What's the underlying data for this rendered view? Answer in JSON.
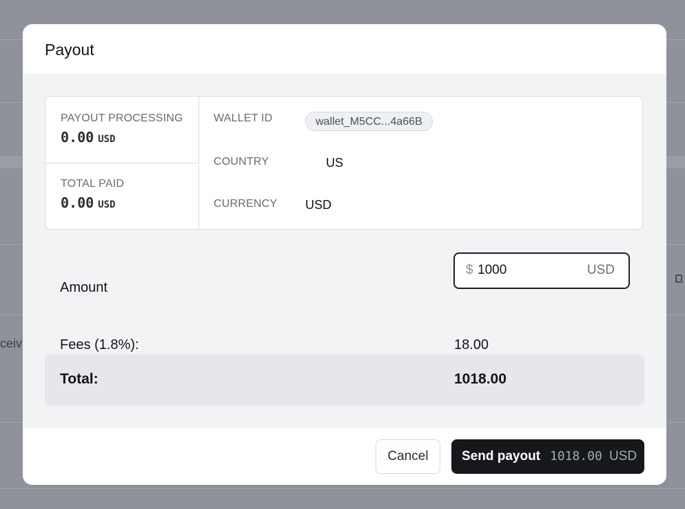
{
  "background": {
    "partial_text": "ceiv"
  },
  "modal": {
    "title": "Payout",
    "stats": {
      "processing_label": "PAYOUT PROCESSING",
      "processing_value": "0.00",
      "processing_unit": "USD",
      "paid_label": "TOTAL PAID",
      "paid_value": "0.00",
      "paid_unit": "USD"
    },
    "details": {
      "wallet_label": "WALLET ID",
      "wallet_value": "wallet_M5CC...4a66B",
      "country_label": "COUNTRY",
      "country_value": "US",
      "currency_label": "CURRENCY",
      "currency_value": "USD"
    },
    "amount": {
      "label": "Amount",
      "prefix": "$",
      "value": "1000",
      "suffix": "USD"
    },
    "fees": {
      "label": "Fees (1.8%):",
      "value": "18.00"
    },
    "total": {
      "label": "Total:",
      "value": "1018.00"
    },
    "footer": {
      "cancel_label": "Cancel",
      "send_label": "Send payout",
      "send_amount": "1018.00",
      "send_unit": "USD"
    }
  },
  "colors": {
    "overlay": "#8f929b",
    "primary_button": "#16181c",
    "body_bg": "#f2f3f5",
    "total_bg": "#e5e7eb"
  }
}
